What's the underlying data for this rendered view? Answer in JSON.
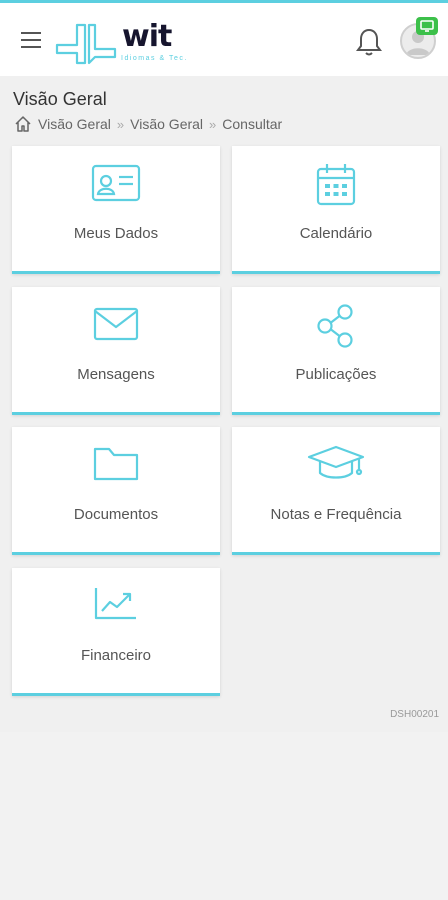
{
  "header": {
    "menu_icon": "hamburger-menu-icon",
    "logo_word": "wit",
    "logo_tagline": "Idiomas & Tec.",
    "notification_icon": "bell-icon",
    "avatar_icon": "user-avatar-icon",
    "badge_icon": "monitor-icon"
  },
  "page": {
    "title": "Visão Geral",
    "breadcrumb": [
      "Visão Geral",
      "Visão Geral",
      "Consultar"
    ]
  },
  "cards": [
    {
      "label": "Meus Dados",
      "icon": "id-card-icon"
    },
    {
      "label": "Calendário",
      "icon": "calendar-icon"
    },
    {
      "label": "Mensagens",
      "icon": "envelope-icon"
    },
    {
      "label": "Publicações",
      "icon": "share-icon"
    },
    {
      "label": "Documentos",
      "icon": "folder-icon"
    },
    {
      "label": "Notas e Frequência",
      "icon": "graduation-cap-icon"
    },
    {
      "label": "Financeiro",
      "icon": "trend-chart-icon"
    }
  ],
  "screen_code": "DSH00201",
  "colors": {
    "accent": "#5ccfe0",
    "logo_dark": "#16152e",
    "badge_green": "#3cc04a",
    "background": "#f0f0f0"
  }
}
